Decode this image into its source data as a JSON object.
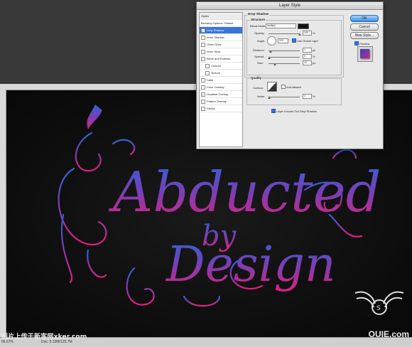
{
  "dialog": {
    "title": "Layer Style",
    "styles_header": "Styles",
    "blending_options": "Blending Options: Default",
    "effects": [
      {
        "label": "Drop Shadow",
        "checked": true,
        "selected": true
      },
      {
        "label": "Inner Shadow",
        "checked": false
      },
      {
        "label": "Outer Glow",
        "checked": false
      },
      {
        "label": "Inner Glow",
        "checked": false
      },
      {
        "label": "Bevel and Emboss",
        "checked": false
      },
      {
        "label": "Contour",
        "checked": false,
        "sub": true
      },
      {
        "label": "Texture",
        "checked": false,
        "sub": true
      },
      {
        "label": "Satin",
        "checked": false
      },
      {
        "label": "Color Overlay",
        "checked": false
      },
      {
        "label": "Gradient Overlay",
        "checked": true
      },
      {
        "label": "Pattern Overlay",
        "checked": false
      },
      {
        "label": "Stroke",
        "checked": false
      }
    ],
    "drop_shadow": {
      "group_title": "Drop Shadow",
      "structure_title": "Structure",
      "blend_mode_label": "Blend Mode:",
      "blend_mode_value": "Multiply",
      "shadow_color": "#111111",
      "opacity_label": "Opacity:",
      "opacity_value": "100",
      "percent": "%",
      "angle_label": "Angle:",
      "angle_value": "120",
      "degree": "°",
      "use_global_light": "Use Global Light",
      "distance_label": "Distance:",
      "distance_value": "1",
      "spread_label": "Spread:",
      "spread_value": "0",
      "size_label": "Size:",
      "size_value": "10",
      "px": "px",
      "quality_title": "Quality",
      "contour_label": "Contour:",
      "anti_aliased": "Anti-aliased",
      "noise_label": "Noise:",
      "noise_value": "0",
      "knocks_out": "Layer Knocks Out Drop Shadow"
    },
    "buttons": {
      "ok": "OK",
      "cancel": "Cancel",
      "new_style": "New Style...",
      "preview": "Preview"
    }
  },
  "canvas": {
    "artwork_text": [
      "Abducted",
      "by",
      "Design"
    ],
    "gradient_top": "#3a5fd0",
    "gradient_bottom": "#e0207a"
  },
  "status": {
    "zoom": "66.67%",
    "doc": "Doc: 5.10M/125.7M"
  },
  "watermarks": {
    "left": "图片上传于新客网xker.com",
    "right": "OUIE.com"
  }
}
